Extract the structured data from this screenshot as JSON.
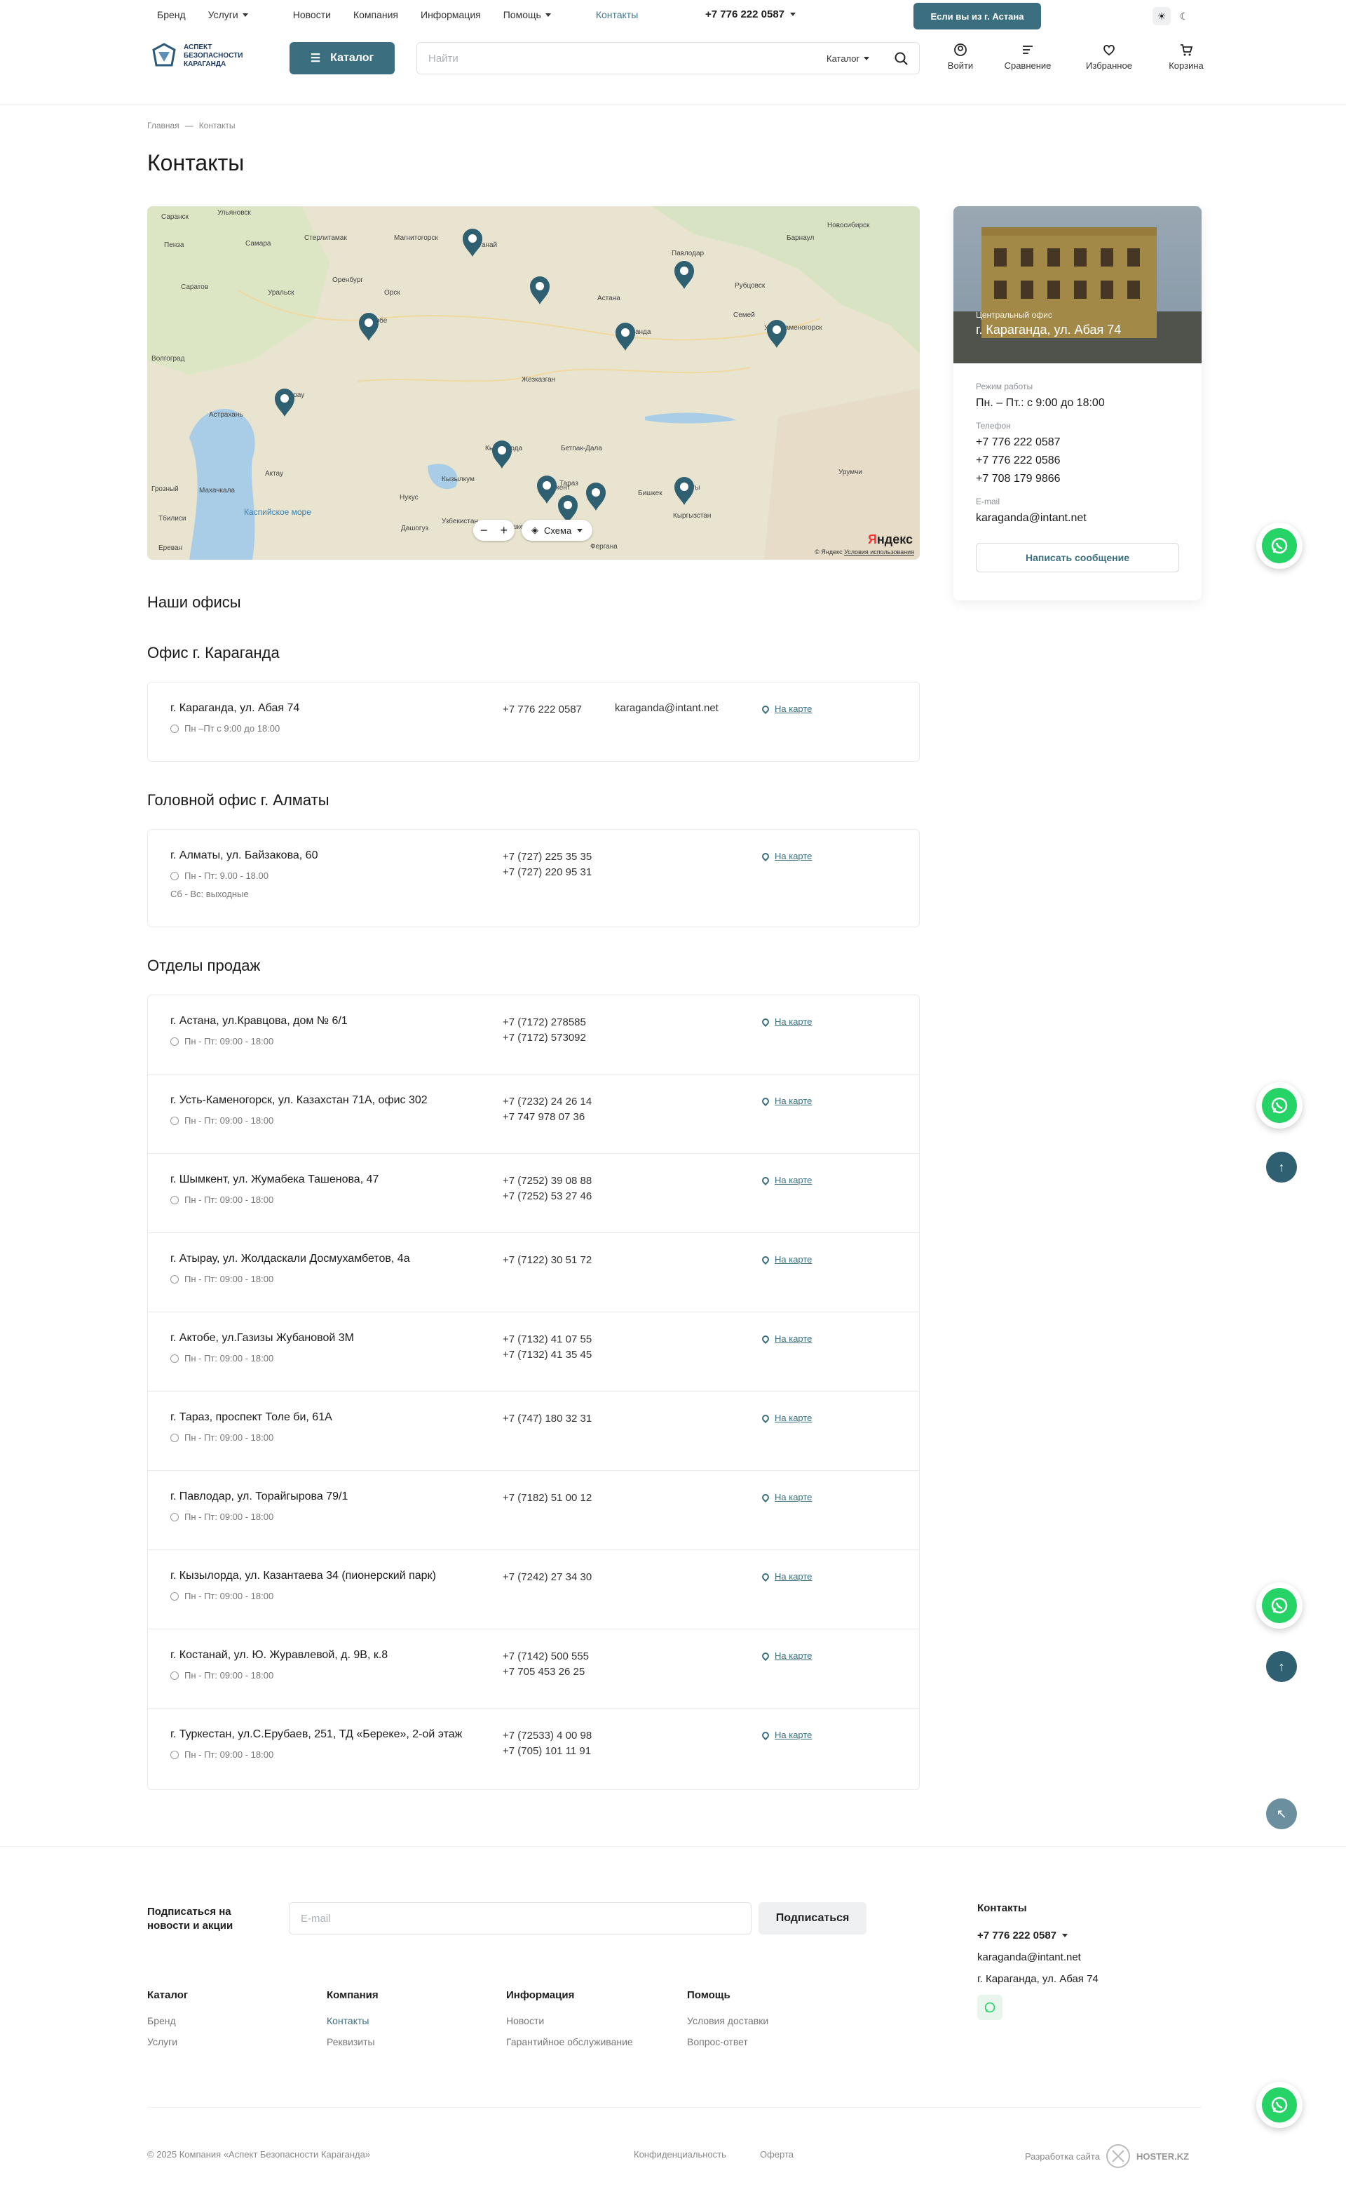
{
  "topnav": {
    "items": [
      {
        "label": "Бренд"
      },
      {
        "label": "Услуги",
        "dropdown": true
      },
      {
        "label": "Новости"
      },
      {
        "label": "Компания"
      },
      {
        "label": "Информация"
      },
      {
        "label": "Помощь",
        "dropdown": true
      },
      {
        "label": "Контакты",
        "active": true
      }
    ],
    "phone": "+7 776 222 0587",
    "city_button": "Если вы из г. Астана"
  },
  "header": {
    "logo_text": [
      "АСПЕКТ",
      "БЕЗОПАСНОСТИ",
      "КАРАГАНДА"
    ],
    "catalog_label": "Каталог",
    "search_placeholder": "Найти",
    "search_scope": "Каталог",
    "icons": [
      {
        "name": "user-icon",
        "label": "Войти"
      },
      {
        "name": "compare-icon",
        "label": "Сравнение"
      },
      {
        "name": "heart-icon",
        "label": "Избранное"
      },
      {
        "name": "cart-icon",
        "label": "Корзина"
      }
    ]
  },
  "breadcrumb": {
    "home": "Главная",
    "current": "Контакты"
  },
  "page_title": "Контакты",
  "map": {
    "cities": [
      "Саранск",
      "Ульяновск",
      "Пенза",
      "Самара",
      "Стерлитамак",
      "Магнитогорск",
      "Костанай",
      "Павлодар",
      "Новосибирск",
      "Барнаул",
      "Саратов",
      "Оренбург",
      "Орск",
      "Астана",
      "Рубцовск",
      "Уральск",
      "Актобе",
      "Караганда",
      "Семей",
      "Усть-Каменогорск",
      "Волгоград",
      "Жезказган",
      "Атырау",
      "Астрахань",
      "Кызылорда",
      "Бетпак-Дала",
      "Кызылкум",
      "Актау",
      "Тараз",
      "Шымкент",
      "Бишкек",
      "Алматы",
      "Урумчи",
      "Грозный",
      "Махачкала",
      "Нукус",
      "Каспийское море",
      "Дашогуз",
      "Ташкент",
      "Узбекистан",
      "Кыргызстан",
      "Фергана",
      "Тбилиси",
      "Ереван"
    ],
    "zoom_out": "−",
    "zoom_in": "+",
    "layer_label": "Схема",
    "copyright": "© Яндекс",
    "terms": "Условия использования",
    "brand": "Яндекс"
  },
  "office_card": {
    "photo_label": "Центральный офис",
    "photo_address": "г. Караганда, ул. Абая 74",
    "hours_label": "Режим работы",
    "hours": "Пн. – Пт.: с 9:00 до 18:00",
    "phone_label": "Телефон",
    "phones": [
      "+7 776 222 0587",
      "+7 776 222 0586",
      "+7 708 179 9866"
    ],
    "email_label": "E-mail",
    "email": "karaganda@intant.net",
    "button": "Написать сообщение"
  },
  "sections": {
    "offices_title": "Наши офисы",
    "karaganda_title": "Офис г. Караганда",
    "almaty_title": "Головной офис г. Алматы",
    "sales_title": "Отделы продаж"
  },
  "map_link": "На карте",
  "karaganda": {
    "address": "г. Караганда, ул. Абая 74",
    "hours": "Пн –Пт с 9:00 до 18:00",
    "phone": "+7 776 222 0587",
    "email": "karaganda@intant.net"
  },
  "almaty": {
    "address": "г. Алматы, ул. Байзакова, 60",
    "hours": "Пн - Пт: 9.00 - 18.00",
    "weekend": "Сб - Вс: выходные",
    "phones": [
      "+7 (727) 225 35 35",
      "+7 (727) 220 95 31"
    ]
  },
  "sales": [
    {
      "address": "г. Астана, ул.Кравцова, дом № 6/1",
      "hours": "Пн - Пт: 09:00 - 18:00",
      "phones": [
        "+7 (7172) 278585",
        "+7 (7172) 573092"
      ]
    },
    {
      "address": "г. Усть-Каменогорск, ул. Казахстан 71А, офис 302",
      "hours": "Пн - Пт: 09:00 - 18:00",
      "phones": [
        "+7 (7232) 24 26 14",
        "+7 747 978 07 36"
      ]
    },
    {
      "address": "г. Шымкент, ул. Жумабека Ташенова, 47",
      "hours": "Пн - Пт: 09:00 - 18:00",
      "phones": [
        "+7 (7252) 39 08 88",
        "+7 (7252) 53 27 46"
      ]
    },
    {
      "address": "г. Атырау, ул. Жолдаскали Досмухамбетов, 4а",
      "hours": "Пн - Пт: 09:00 - 18:00",
      "phones": [
        "+7 (7122) 30 51 72"
      ]
    },
    {
      "address": "г. Актобе, ул.Газизы Жубановой 3М",
      "hours": "Пн - Пт: 09:00 - 18:00",
      "phones": [
        "+7 (7132) 41 07 55",
        "+7 (7132) 41 35 45"
      ]
    },
    {
      "address": "г. Тараз, проспект Толе би, 61А",
      "hours": "Пн - Пт: 09:00 - 18:00",
      "phones": [
        "+7 (747) 180 32 31"
      ]
    },
    {
      "address": "г. Павлодар, ул. Торайгырова 79/1",
      "hours": "Пн - Пт: 09:00 - 18:00",
      "phones": [
        "+7 (7182) 51 00 12"
      ]
    },
    {
      "address": "г. Кызылорда, ул. Казантаева 34 (пионерский парк)",
      "hours": "Пн - Пт: 09:00 - 18:00",
      "phones": [
        "+7 (7242) 27 34 30"
      ]
    },
    {
      "address": "г. Костанай, ул. Ю. Журавлевой, д. 9В, к.8",
      "hours": "Пн - Пт: 09:00 - 18:00",
      "phones": [
        "+7 (7142) 500 555",
        "+7 705 453 26 25"
      ]
    },
    {
      "address": "г. Туркестан, ул.С.Ерубаев, 251, ТД «Береке», 2-ой этаж",
      "hours": "Пн - Пт: 09:00 - 18:00",
      "phones": [
        "+7 (72533) 4 00 98",
        "+7 (705) 101 11 91"
      ]
    }
  ],
  "footer": {
    "subscribe_title": "Подписаться на новости и акции",
    "email_placeholder": "E-mail",
    "subscribe_button": "Подписаться",
    "columns": [
      {
        "title": "Каталог",
        "links": [
          "Бренд",
          "Услуги"
        ]
      },
      {
        "title": "Компания",
        "links": [
          "Контакты",
          "Реквизиты"
        ]
      },
      {
        "title": "Информация",
        "links": [
          "Новости",
          "Гарантийное обслуживание"
        ]
      },
      {
        "title": "Помощь",
        "links": [
          "Условия доставки",
          "Вопрос-ответ"
        ]
      }
    ],
    "contacts": {
      "title": "Контакты",
      "phone": "+7 776 222 0587",
      "email": "karaganda@intant.net",
      "address": "г. Караганда, ул. Абая 74"
    },
    "copyright": "© 2025 Компания «Аспект Безопасности Караганда»",
    "privacy": "Конфиденциальность",
    "offer": "Оферта",
    "dev_label": "Разработка сайта",
    "dev_brand": "HOSTER.KZ"
  },
  "colors": {
    "accent": "#3b6f80",
    "whatsapp": "#25d366"
  }
}
